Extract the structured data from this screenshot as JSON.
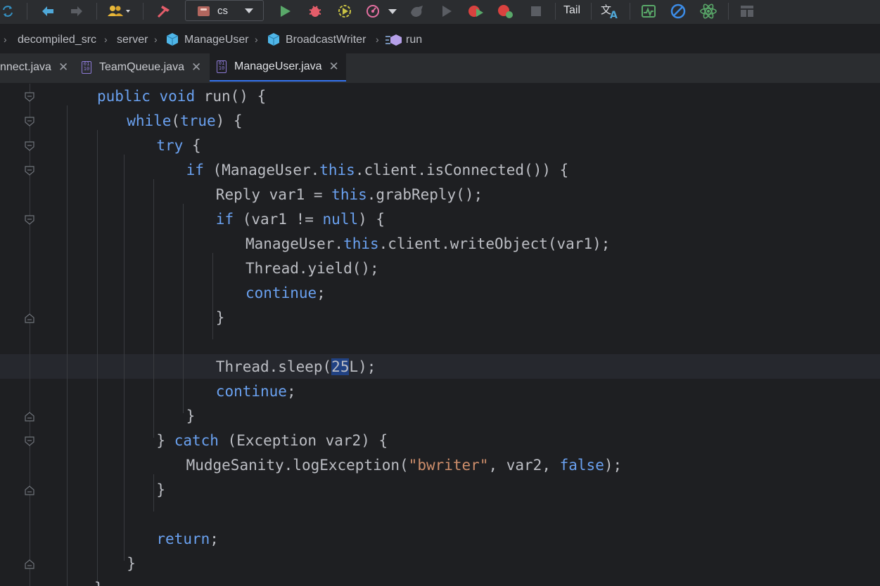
{
  "toolbar": {
    "run_config": "cs",
    "tail_label": "Tail",
    "icons": [
      "sync-icon",
      "back-arrow-icon",
      "forward-arrow-icon",
      "users-icon",
      "build-hammer-icon",
      "run-icon",
      "debug-icon",
      "coverage-icon",
      "profiler-icon",
      "attach-icon",
      "resume-icon",
      "record-icon",
      "debug-record-icon",
      "stop-icon",
      "translate-icon",
      "monitor-icon",
      "block-icon",
      "react-icon",
      "layout-icon"
    ],
    "colors": {
      "run": "#59a869",
      "debug": "#e45d6a",
      "coverage": "#c9c244",
      "profile": "#e36fa0",
      "accent": "#3574f0"
    }
  },
  "breadcrumb": {
    "items": [
      "decompiled_src",
      "server",
      "ManageUser",
      "BroadcastWriter",
      "run"
    ]
  },
  "tabs": [
    {
      "label": "nnect.java",
      "active": false
    },
    {
      "label": "TeamQueue.java",
      "active": false
    },
    {
      "label": "ManageUser.java",
      "active": true
    }
  ],
  "editor": {
    "lines": [
      [
        {
          "t": "public ",
          "c": "kw"
        },
        {
          "t": "void ",
          "c": "kw"
        },
        {
          "t": "run() {",
          "c": ""
        }
      ],
      [
        {
          "t": "while",
          "c": "kw"
        },
        {
          "t": "(",
          "c": ""
        },
        {
          "t": "true",
          "c": "kw"
        },
        {
          "t": ") {",
          "c": ""
        }
      ],
      [
        {
          "t": "try ",
          "c": "kw"
        },
        {
          "t": "{",
          "c": ""
        }
      ],
      [
        {
          "t": "if ",
          "c": "kw"
        },
        {
          "t": "(ManageUser.",
          "c": ""
        },
        {
          "t": "this",
          "c": "kw"
        },
        {
          "t": ".client.isConnected()) {",
          "c": ""
        }
      ],
      [
        {
          "t": "Reply var1 = ",
          "c": ""
        },
        {
          "t": "this",
          "c": "kw"
        },
        {
          "t": ".grabReply();",
          "c": ""
        }
      ],
      [
        {
          "t": "if ",
          "c": "kw"
        },
        {
          "t": "(var1 != ",
          "c": ""
        },
        {
          "t": "null",
          "c": "kw"
        },
        {
          "t": ") {",
          "c": ""
        }
      ],
      [
        {
          "t": "ManageUser.",
          "c": ""
        },
        {
          "t": "this",
          "c": "kw"
        },
        {
          "t": ".client.writeObject(var1);",
          "c": ""
        }
      ],
      [
        {
          "t": "Thread.yield();",
          "c": ""
        }
      ],
      [
        {
          "t": "continue",
          "c": "kw"
        },
        {
          "t": ";",
          "c": ""
        }
      ],
      [
        {
          "t": "}",
          "c": ""
        }
      ],
      [],
      [
        {
          "t": "Thread.sleep(",
          "c": ""
        },
        {
          "t": "25",
          "c": "sel"
        },
        {
          "t": "L);",
          "c": ""
        }
      ],
      [
        {
          "t": "continue",
          "c": "kw"
        },
        {
          "t": ";",
          "c": ""
        }
      ],
      [
        {
          "t": "}",
          "c": ""
        }
      ],
      [
        {
          "t": "} ",
          "c": ""
        },
        {
          "t": "catch ",
          "c": "kw"
        },
        {
          "t": "(Exception var2) {",
          "c": ""
        }
      ],
      [
        {
          "t": "MudgeSanity.logException(",
          "c": ""
        },
        {
          "t": "\"bwriter\"",
          "c": "str"
        },
        {
          "t": ", var2, ",
          "c": ""
        },
        {
          "t": "false",
          "c": "kw"
        },
        {
          "t": ");",
          "c": ""
        }
      ],
      [
        {
          "t": "}",
          "c": ""
        }
      ],
      [],
      [
        {
          "t": "return",
          "c": "kw"
        },
        {
          "t": ";",
          "c": ""
        }
      ],
      [
        {
          "t": "}",
          "c": ""
        }
      ],
      [
        {
          "t": "}",
          "c": ""
        }
      ]
    ]
  }
}
